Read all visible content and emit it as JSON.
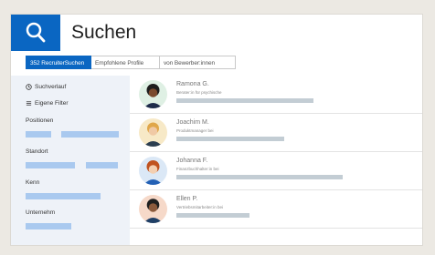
{
  "app": {
    "title": "Suchen"
  },
  "tabs": [
    {
      "label": "352 RecruiterSuchen",
      "active": true
    },
    {
      "label": "Empfohlene Profile",
      "active": false
    },
    {
      "label": "von Bewerber:innen",
      "active": false
    }
  ],
  "sidebar": {
    "history_label": "Suchverlauf",
    "filters_label": "Eigene Filter",
    "sections": [
      "Positionen",
      "Standort",
      "Kenn",
      "Unternehm"
    ]
  },
  "candidates": [
    {
      "name": "Ramona G.",
      "role": "Berater:in für psychische"
    },
    {
      "name": "Joachim M.",
      "role": "Produktmanager bei"
    },
    {
      "name": "Johanna F.",
      "role": "Finanzbuchhalter:in bei"
    },
    {
      "name": "Ellen P.",
      "role": "Vertriebsmitarbeiter:in bei"
    }
  ],
  "colors": {
    "brand": "#0a66c2",
    "sidebar_bg": "#eef2f8",
    "placeholder_bar": "#a9c9ef",
    "row_bar": "#c3cdd4"
  },
  "icons": [
    "search-icon",
    "clock-icon",
    "filter-icon"
  ]
}
